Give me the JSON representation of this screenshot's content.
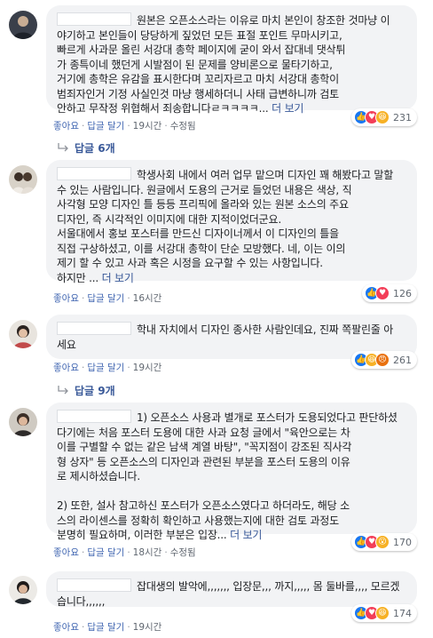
{
  "comments": [
    {
      "text": "원본은 오픈소스라는 이유로 마치 본인이 창조한 것마냥 이\n야기하고 본인들이 당당하게 짚었던 모든 표절 포인트 무마시키고,\n빠르게 사과문 올린 서강대 총학 페이지에 굳이 와서 잡대네 댓삭튀\n가 종특이네 했던게 시발점이 된 문제를 양비론으로 물타기하고,\n거기에 총학은 유감을 표시한다며 꼬리자르고 마치 서강대 총학이\n범죄자인거 기정 사실인것 마냥 행세하더니 사태 급변하니까 검토\n안하고 무작정 위협해서 죄송합니다ㄹㅋㅋㅋㅋ... ",
      "more": "더 보기",
      "like": "좋아요",
      "reply": "답글 달기",
      "time": "19시간",
      "edited": "수정됨",
      "reaction_count": "231",
      "replies_label": "답글 6개"
    },
    {
      "text": "학생사회 내에서 여러 업무 맡으며 디자인 꽤 해봤다고 말할\n수 있는 사람입니다. 원글에서 도용의 근거로 들었던 내용은 색상, 직\n사각형 모양 디자인 틀 등등 프리픽에 올라와 있는 원본 소스의 주요\n디자인, 즉 시각적인 이미지에 대한 지적이었더군요.\n서울대에서 홍보 포스터를 만드신 디자이너께서 이 디자인의 틀을\n직접 구상하셨고, 이를 서강대 총학이 단순 모방했다. 네, 이는 이의\n제기 할 수 있고 사과 혹은 시정을 요구할 수 있는 사항입니다.\n하지만 ... ",
      "more": "더 보기",
      "like": "좋아요",
      "reply": "답글 달기",
      "time": "16시간",
      "reaction_count": "126"
    },
    {
      "text": "학내 자치에서 디자인 종사한 사람인데요, 진짜 쪽팔린줄 아\n세요",
      "like": "좋아요",
      "reply": "답글 달기",
      "time": "19시간",
      "reaction_count": "261",
      "replies_label": "답글 9개"
    },
    {
      "text": "1) 오픈소스 사용과 별개로 포스터가 도용되었다고 판단하셨\n다기에는 처음 포스터 도용에 대한 사과 요청 글에서 \"육안으로는 차\n이를 구별할 수 없는 같은 남색 계열 바탕\", \"꼭지점이 강조된 직사각\n형 상자\" 등 오픈소스의 디자인과 관련된 부분을 포스터 도용의 이유\n로 제시하셨습니다.\n\n2) 또한, 설사 참고하신 포스터가 오픈소스였다고 하더라도, 해당 소\n스의 라이센스를 정확히 확인하고 사용했는지에 대한 검토 과정도\n분명히 필요하며, 이러한 부분은 입장... ",
      "more": "더 보기",
      "like": "좋아요",
      "reply": "답글 달기",
      "time": "18시간",
      "edited": "수정됨",
      "reaction_count": "170"
    },
    {
      "text": "잡대생의 발악에,,,,,,, 입장문,,, 까지,,,,, 몸 둘바를,,,, 모르겠\n습니다,,,,,,",
      "like": "좋아요",
      "reply": "답글 달기",
      "time": "19시간",
      "reaction_count": "174"
    }
  ],
  "colors": {
    "bubble": "#f2f3f5",
    "link": "#385898",
    "muted": "#606770",
    "like": "#1877f2",
    "love": "#f33e58",
    "haha": "#f7b125",
    "angry": "#e9710f"
  },
  "reaction_icons": [
    "like-icon",
    "love-icon",
    "haha-icon",
    "angry-icon"
  ]
}
